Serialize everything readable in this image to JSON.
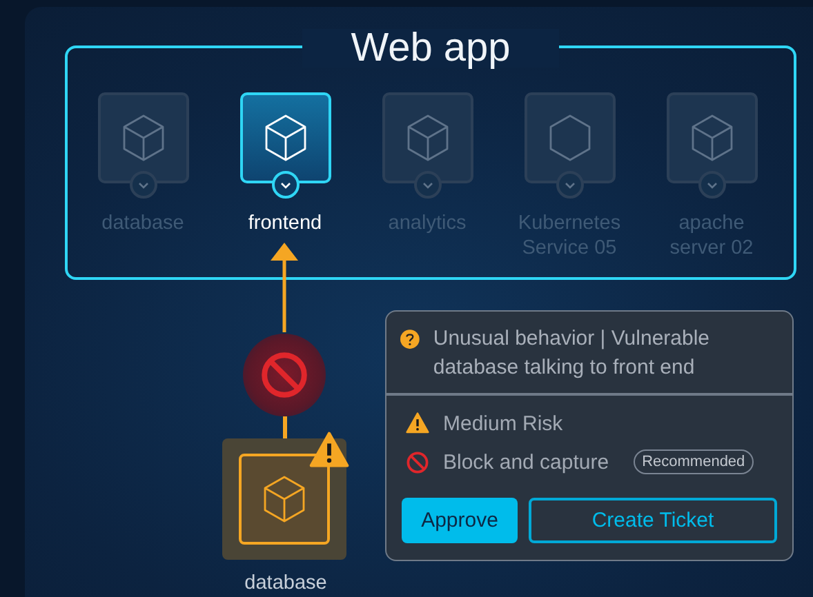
{
  "group": {
    "title": "Web app",
    "nodes": [
      {
        "label": "database",
        "kind": "cube",
        "selected": false
      },
      {
        "label": "frontend",
        "kind": "cube",
        "selected": true
      },
      {
        "label": "analytics",
        "kind": "cube",
        "selected": false
      },
      {
        "label": "Kubernetes Service 05",
        "kind": "hexagon",
        "selected": false
      },
      {
        "label": "apache server 02",
        "kind": "cube",
        "selected": false
      }
    ]
  },
  "source": {
    "label": "database",
    "kind": "cube",
    "warning": true,
    "blocked": true
  },
  "alert": {
    "title": "Unusual behavior | Vulnerable database talking to front end",
    "rows": [
      {
        "kind": "risk",
        "text": "Medium Risk"
      },
      {
        "kind": "action",
        "text": "Block and capture",
        "badge": "Recommended"
      }
    ],
    "buttons": [
      {
        "label": "Approve",
        "kind": "primary"
      },
      {
        "label": "Create Ticket",
        "kind": "secondary"
      }
    ]
  }
}
